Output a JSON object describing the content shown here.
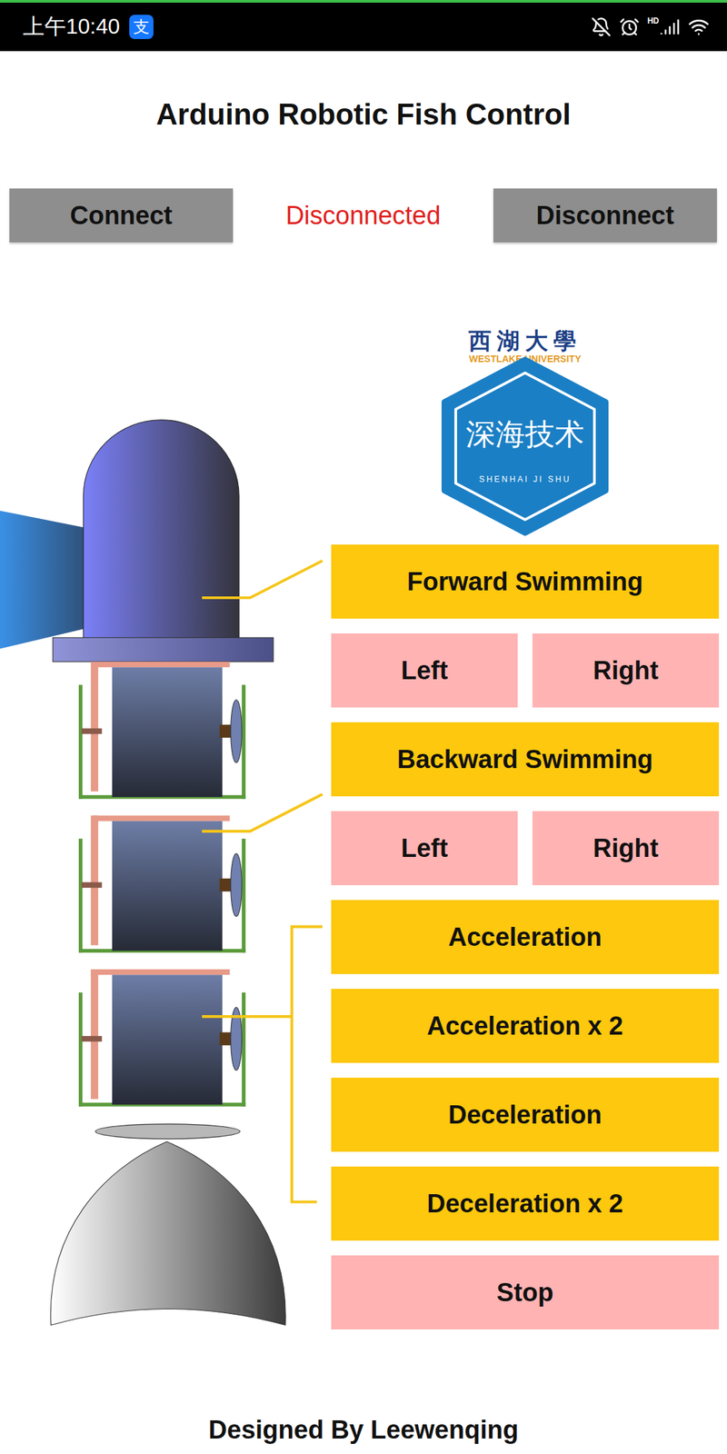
{
  "status_bar": {
    "time": "上午10:40",
    "app_badge": "支",
    "network": "HD"
  },
  "title": "Arduino Robotic Fish Control",
  "connection": {
    "connect_button": "Connect",
    "status": "Disconnected",
    "connected": false,
    "disconnect_button": "Disconnect"
  },
  "logo": {
    "name": "西湖大學",
    "subtitle": "WESTLAKE UNIVERSITY",
    "emblem": "深海技术",
    "emblem_caption": "SHENHAI JI SHU"
  },
  "controls": [
    {
      "buttons": [
        {
          "label": "Forward Swimming",
          "color": "#fdc80d"
        }
      ]
    },
    {
      "buttons": [
        {
          "label": "Left",
          "color": "#ffb3b3"
        },
        {
          "label": "Right",
          "color": "#ffb3b3"
        }
      ]
    },
    {
      "buttons": [
        {
          "label": "Backward Swimming",
          "color": "#fdc80d"
        }
      ]
    },
    {
      "buttons": [
        {
          "label": "Left",
          "color": "#ffb3b3"
        },
        {
          "label": "Right",
          "color": "#ffb3b3"
        }
      ]
    },
    {
      "buttons": [
        {
          "label": "Acceleration",
          "color": "#fdc80d"
        }
      ]
    },
    {
      "buttons": [
        {
          "label": "Acceleration x 2",
          "color": "#fdc80d"
        }
      ]
    },
    {
      "buttons": [
        {
          "label": "Deceleration",
          "color": "#fdc80d"
        }
      ]
    },
    {
      "buttons": [
        {
          "label": "Deceleration x 2",
          "color": "#fdc80d"
        }
      ]
    },
    {
      "buttons": [
        {
          "label": "Stop",
          "color": "#ffb3b3"
        }
      ]
    }
  ],
  "footer": "Designed By Leewenqing"
}
